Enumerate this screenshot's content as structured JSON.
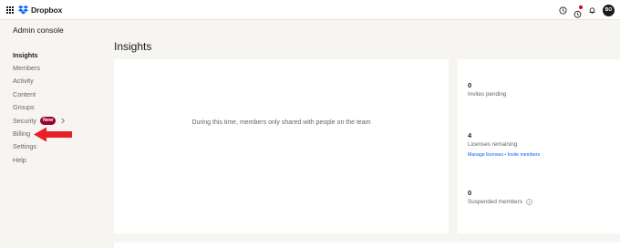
{
  "app": {
    "logo_text": "Dropbox",
    "avatar_initials": "BO"
  },
  "sidebar": {
    "title": "Admin console",
    "items": [
      {
        "label": "Insights",
        "active": true
      },
      {
        "label": "Members"
      },
      {
        "label": "Activity"
      },
      {
        "label": "Content"
      },
      {
        "label": "Groups"
      },
      {
        "label": "Security",
        "badge": "New"
      },
      {
        "label": "Billing"
      },
      {
        "label": "Settings"
      },
      {
        "label": "Help"
      }
    ]
  },
  "main": {
    "title": "Insights",
    "empty_message": "During this time, members only shared with people on the team"
  },
  "stats": {
    "invites": {
      "value": "0",
      "label": "Invites pending"
    },
    "licenses": {
      "value": "4",
      "label": "Licenses remaining",
      "link_manage": "Manage licenses",
      "separator": " • ",
      "link_invite": "Invite members"
    },
    "suspended": {
      "value": "0",
      "label": "Suspended members"
    }
  },
  "colors": {
    "accent": "#0061fe",
    "badge": "#9b0032",
    "arrow": "#e8202a",
    "background": "#f7f5f2"
  }
}
